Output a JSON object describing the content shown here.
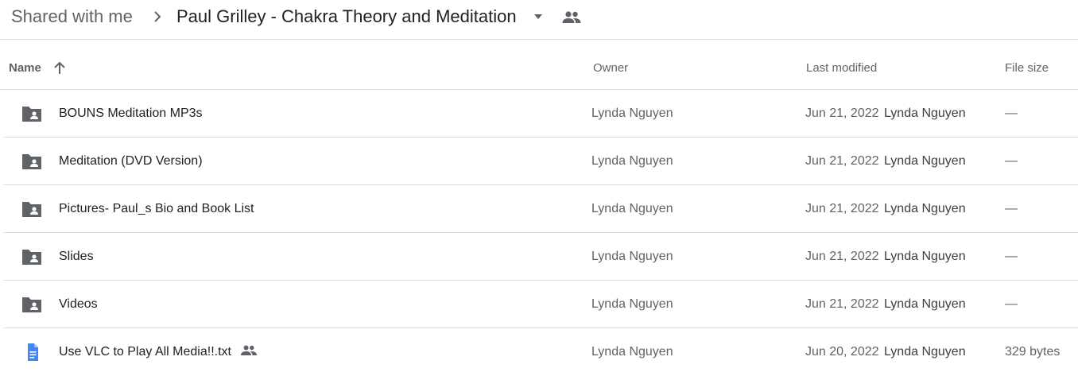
{
  "breadcrumb": {
    "root": "Shared with me",
    "current": "Paul Grilley - Chakra Theory and Meditation",
    "separator_icon": "chevron-right-icon",
    "dropdown_icon": "arrow-drop-down-icon",
    "shared_icon": "people-icon"
  },
  "columns": {
    "name": "Name",
    "owner": "Owner",
    "last_modified": "Last modified",
    "file_size": "File size",
    "sort_icon": "arrow-up-icon",
    "sort_direction": "ascending"
  },
  "colors": {
    "folder_icon": "#5f6368",
    "doc_icon": "#4285f4",
    "divider": "#dadce0",
    "text_primary": "#202124",
    "text_secondary": "#5f6368"
  },
  "files": [
    {
      "name": "BOUNS Meditation MP3s",
      "type": "folder",
      "icon": "shared-folder-icon",
      "owner": "Lynda Nguyen",
      "date": "Jun 21, 2022",
      "modifier": "Lynda Nguyen",
      "size": "—",
      "shared": false
    },
    {
      "name": "Meditation (DVD Version)",
      "type": "folder",
      "icon": "shared-folder-icon",
      "owner": "Lynda Nguyen",
      "date": "Jun 21, 2022",
      "modifier": "Lynda Nguyen",
      "size": "—",
      "shared": false
    },
    {
      "name": "Pictures- Paul_s Bio and Book List",
      "type": "folder",
      "icon": "shared-folder-icon",
      "owner": "Lynda Nguyen",
      "date": "Jun 21, 2022",
      "modifier": "Lynda Nguyen",
      "size": "—",
      "shared": false
    },
    {
      "name": "Slides",
      "type": "folder",
      "icon": "shared-folder-icon",
      "owner": "Lynda Nguyen",
      "date": "Jun 21, 2022",
      "modifier": "Lynda Nguyen",
      "size": "—",
      "shared": false
    },
    {
      "name": "Videos",
      "type": "folder",
      "icon": "shared-folder-icon",
      "owner": "Lynda Nguyen",
      "date": "Jun 21, 2022",
      "modifier": "Lynda Nguyen",
      "size": "—",
      "shared": false
    },
    {
      "name": "Use VLC to Play All Media!!.txt",
      "type": "document",
      "icon": "document-icon",
      "owner": "Lynda Nguyen",
      "date": "Jun 20, 2022",
      "modifier": "Lynda Nguyen",
      "size": "329 bytes",
      "shared": true
    }
  ]
}
